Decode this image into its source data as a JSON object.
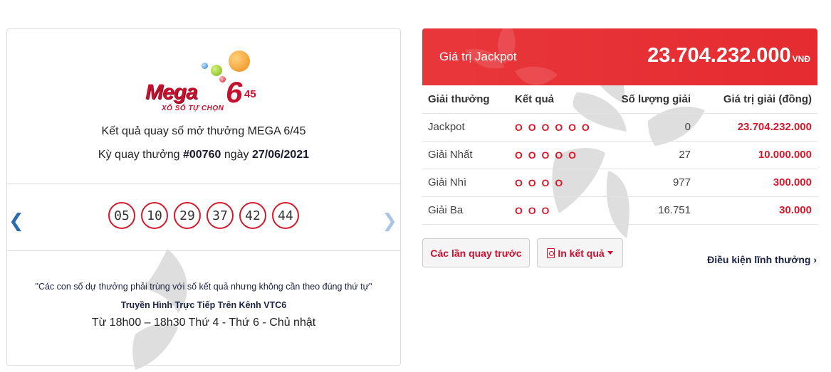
{
  "draw_card": {
    "logo": {
      "word": "Mega",
      "six": "6",
      "forty_five": "45",
      "tagline": "XỔ SỐ TỰ CHỌN"
    },
    "headline": "Kết quả quay số mở thưởng MEGA 6/45",
    "draw_label": "Kỳ quay thưởng",
    "draw_number": "#00760",
    "date_label": "ngày",
    "draw_date": "27/06/2021",
    "numbers": [
      "05",
      "10",
      "29",
      "37",
      "42",
      "44"
    ],
    "prev_icon": "chevron-left-icon",
    "next_icon": "chevron-right-icon",
    "note": "\"Các con số dự thưởng phải trùng với số kết quả nhưng không cần theo đúng thứ tự\"",
    "broadcast": "Truyền Hình Trực Tiếp Trên Kênh VTC6",
    "schedule": "Từ 18h00 – 18h30 Thứ 4 - Thứ 6 - Chủ nhật"
  },
  "jackpot": {
    "label": "Giá trị Jackpot",
    "amount": "23.704.232.000",
    "unit": "VNĐ"
  },
  "prize_table": {
    "headers": [
      "Giải thưởng",
      "Kết quả",
      "Số lượng giải",
      "Giá trị giải (đồng)"
    ],
    "rows": [
      {
        "name": "Jackpot",
        "match": "O O O O O O",
        "count": "0",
        "value": "23.704.232.000"
      },
      {
        "name": "Giải Nhất",
        "match": "O O O O O",
        "count": "27",
        "value": "10.000.000"
      },
      {
        "name": "Giải Nhì",
        "match": "O O O O",
        "count": "977",
        "value": "300.000"
      },
      {
        "name": "Giải Ba",
        "match": "O O O",
        "count": "16.751",
        "value": "30.000"
      }
    ]
  },
  "actions": {
    "previous_draws": "Các lần quay trước",
    "print_results": "In kết quả",
    "conditions": "Điều kiện lĩnh thưởng"
  },
  "colors": {
    "brand_red": "#d7182a",
    "banner_red": "#e8373b",
    "link_blue": "#2b6cb0"
  }
}
